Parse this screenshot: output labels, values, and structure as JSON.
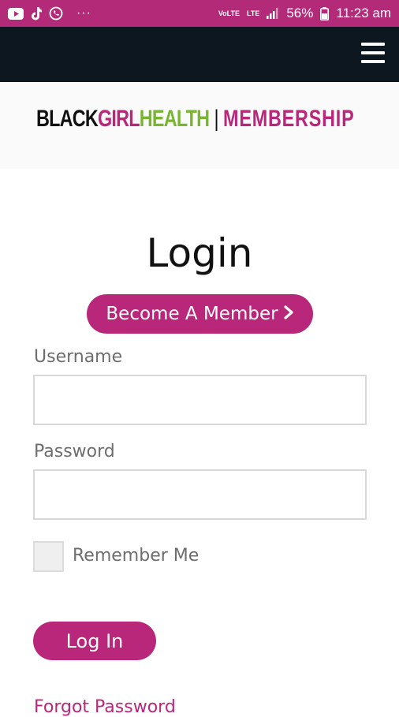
{
  "status_bar": {
    "background": "#b22a78",
    "notification_icons": [
      "youtube-icon",
      "tiktok-icon",
      "whatsapp-icon"
    ],
    "more": "···",
    "network_top": "VoLTE",
    "lte": "LTE",
    "battery_percent": "56%",
    "time": "11:23 am"
  },
  "navbar": {
    "background": "#0d1720",
    "menu_icon": "hamburger-menu-icon"
  },
  "brand": {
    "part_black": "BLACK",
    "part_girl": "GIRL",
    "part_health": "HEALTH",
    "separator": "|",
    "part_membership": "MEMBERSHIP",
    "colors": {
      "black": "#111111",
      "pink": "#b8277a",
      "green": "#7ab532"
    }
  },
  "login_form": {
    "title": "Login",
    "become_member_label": "Become A Member",
    "become_member_icon": "chevron-right-icon",
    "username_label": "Username",
    "username_value": "",
    "password_label": "Password",
    "password_value": "",
    "remember_me_label": "Remember Me",
    "remember_me_checked": false,
    "submit_label": "Log In",
    "forgot_password_label": "Forgot Password"
  },
  "colors": {
    "accent": "#b8277a",
    "label_gray": "#6d6d6d"
  }
}
